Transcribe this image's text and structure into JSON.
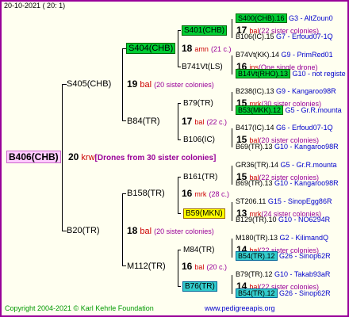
{
  "header": {
    "date": "20-10-2021",
    "time": "( 20: 1)"
  },
  "root": {
    "name": "B406(CHB)",
    "count": "20",
    "abbr": "krw",
    "note": "[Drones from 30 sister colonies]"
  },
  "gen1": [
    {
      "name": "S405(CHB)",
      "count": "19",
      "abbr": "bal",
      "note": "(20 sister colonies)"
    },
    {
      "name": "B20(TR)",
      "count": "18",
      "abbr": "bal",
      "note": "(20 sister colonies)"
    }
  ],
  "gen2": [
    {
      "name": "S404(CHB)",
      "count": "18",
      "abbr": "amn",
      "note": "(21 c.)"
    },
    {
      "name": "B84(TR)",
      "count": "17",
      "abbr": "bal",
      "note": "(22 c.)"
    },
    {
      "name": "B158(TR)",
      "count": "16",
      "abbr": "mrk",
      "note": "(28 c.)"
    },
    {
      "name": "M112(TR)",
      "count": "16",
      "abbr": "bal",
      "note": "(20 c.)"
    }
  ],
  "gen3": [
    {
      "name": "S401(CHB)",
      "count": "17",
      "abbr": "bal",
      "note": "(22 sister colonies)"
    },
    {
      "name": "B741Vt(LS)",
      "count": "16",
      "abbr": "ins",
      "note": "(One single drone)"
    },
    {
      "name": "B79(TR)",
      "count": "15",
      "abbr": "mrk",
      "note": "(30 sister colonies)"
    },
    {
      "name": "B106(IC)",
      "count": "15",
      "abbr": "bal",
      "note": "(20 sister colonies)"
    },
    {
      "name": "B161(TR)",
      "count": "15",
      "abbr": "bal",
      "note": "(22 sister colonies)"
    },
    {
      "name": "B59(MKN)",
      "count": "13",
      "abbr": "mrk",
      "note": "(24 sister colonies)"
    },
    {
      "name": "M84(TR)",
      "count": "14",
      "abbr": "bal",
      "note": "(22 sister colonies)"
    },
    {
      "name": "B76(TR)",
      "count": "14",
      "abbr": "bal",
      "note": "(22 sister colonies)"
    }
  ],
  "gen4": [
    {
      "name": "S400(CHB).16",
      "ref": "G3 - AltZoun0"
    },
    {
      "name": "B106(IC).15",
      "ref": "G7 - Erfoud07-1Q"
    },
    {
      "name": "B74Vt(KK).14",
      "ref": "G9 - PrimRed01"
    },
    {
      "name": "B14Vt(RHO).13",
      "ref": "G10 - not registe"
    },
    {
      "name": "B238(IC).13",
      "ref": "G9 - Kangaroo98R"
    },
    {
      "name": "B53(MKK).12",
      "ref": "G5 - Gr.R.mounta"
    },
    {
      "name": "B417(IC).14",
      "ref": "G6 - Erfoud07-1Q"
    },
    {
      "name": "B69(TR).13",
      "ref": "G10 - Kangaroo98R"
    },
    {
      "name": "GR36(TR).14",
      "ref": "G5 - Gr.R.mounta"
    },
    {
      "name": "B69(TR).13",
      "ref": "G10 - Kangaroo98R"
    },
    {
      "name": "ST206.11",
      "ref": "G15 - SinopEgg86R"
    },
    {
      "name": "B129(TR).10",
      "ref": "G10 - NO6294R"
    },
    {
      "name": "M180(TR).13",
      "ref": "G2 - KilimandQ"
    },
    {
      "name": "B54(TR).12",
      "ref": "G26 - Sinop62R"
    },
    {
      "name": "B79(TR).12",
      "ref": "G10 - Takab93aR"
    },
    {
      "name": "B54(TR).12",
      "ref": "G26 - Sinop62R"
    }
  ],
  "footer": {
    "copyright": "Copyright 2004-2021 © Karl Kehrle Foundation",
    "site": "www.pedigreeapis.org"
  }
}
